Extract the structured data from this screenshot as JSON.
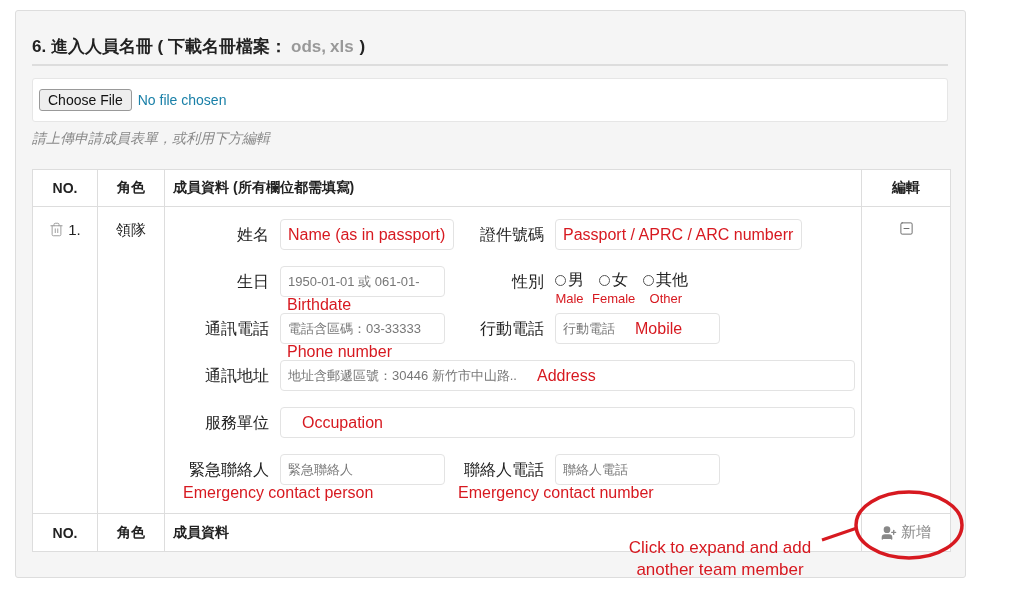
{
  "heading": {
    "title": "6. 進入人員名冊 ( 下載名冊檔案：",
    "links": [
      "ods,",
      "xls"
    ],
    "suffix": ")"
  },
  "file_upload": {
    "button": "Choose File",
    "status": "No file chosen",
    "hint": "請上傳申請成員表單，或利用下方編輯"
  },
  "table": {
    "columns": [
      "NO.",
      "角色",
      "成員資料 (所有欄位都需填寫)",
      "編輯"
    ],
    "rows": [
      {
        "no": "1.",
        "role": "領隊",
        "expanded": true,
        "form_rows": [
          [
            {
              "kind": "text",
              "label": "姓名",
              "note": {
                "text": "Name (as in passport)",
                "kind": "inline"
              }
            },
            {
              "kind": "text",
              "label": "證件號碼",
              "note": {
                "text": "Passport / APRC / ARC numberr",
                "kind": "inline"
              }
            }
          ],
          [
            {
              "kind": "text",
              "label": "生日",
              "placeholder": "1950-01-01 或 061-01-",
              "note": {
                "text": "Birthdate",
                "kind": "under-field"
              }
            },
            {
              "kind": "radio",
              "label": "性別",
              "options": [
                {
                  "label": "男",
                  "note": "Male",
                  "checked": false
                },
                {
                  "label": "女",
                  "note": "Female",
                  "checked": false
                },
                {
                  "label": "其他",
                  "note": "Other",
                  "checked": false
                }
              ]
            }
          ],
          [
            {
              "kind": "text",
              "label": "通訊電話",
              "placeholder": "電話含區碼：03-33333",
              "note": {
                "text": "Phone number",
                "kind": "under-field"
              }
            },
            {
              "kind": "text",
              "label": "行動電話",
              "placeholder": "行動電話",
              "note": {
                "text": "Mobile",
                "kind": "inline"
              }
            }
          ],
          [
            {
              "kind": "wide",
              "label": "通訊地址",
              "placeholder": "地址含郵遞區號：30446 新竹市中山路..",
              "note": {
                "text": "Address",
                "kind": "inline"
              }
            }
          ],
          [
            {
              "kind": "wide",
              "label": "服務單位",
              "note": {
                "text": "Occupation",
                "kind": "inline"
              }
            }
          ],
          [
            {
              "kind": "text",
              "label": "緊急聯絡人",
              "placeholder": "緊急聯絡人",
              "note": {
                "text": "Emergency contact person",
                "kind": "under-label"
              }
            },
            {
              "kind": "text",
              "label": "聯絡人電話",
              "placeholder": "聯絡人電話",
              "note": {
                "text": "Emergency contact number",
                "kind": "under-label"
              }
            }
          ]
        ]
      }
    ],
    "footer": [
      "NO.",
      "角色",
      "成員資料"
    ],
    "add_button": "新增"
  },
  "callout": {
    "text": "Click to expand and add another team member"
  }
}
